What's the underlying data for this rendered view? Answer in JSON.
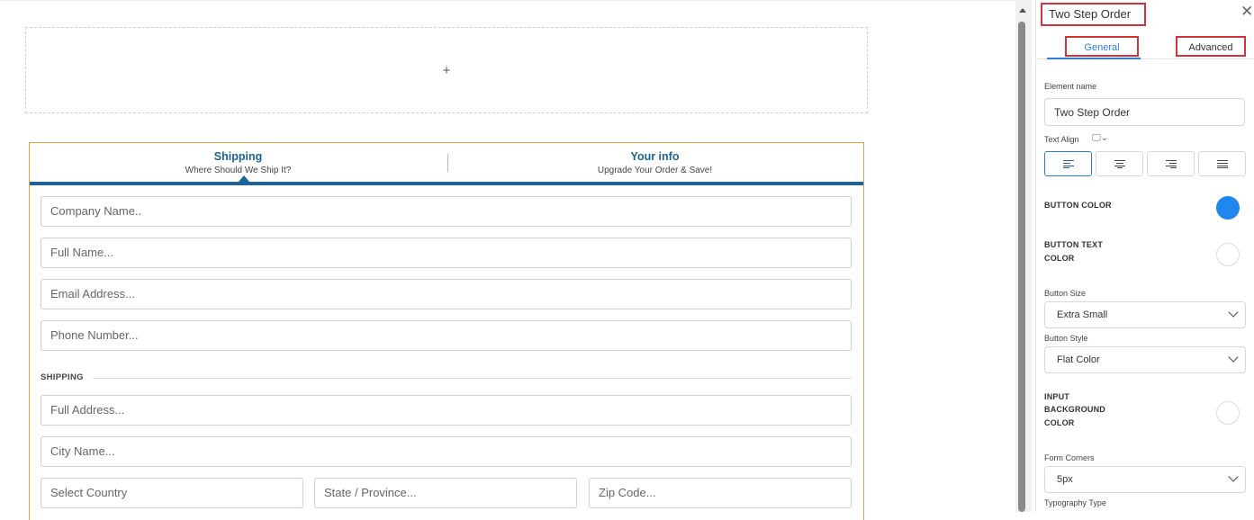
{
  "canvas": {
    "add_section_icon": "+",
    "steps": [
      {
        "title": "Shipping",
        "subtitle": "Where Should We Ship It?"
      },
      {
        "title": "Your info",
        "subtitle": "Upgrade Your Order & Save!"
      }
    ],
    "fields": {
      "company": "Company Name..",
      "full_name": "Full Name...",
      "email": "Email Address...",
      "phone": "Phone Number..."
    },
    "shipping_label": "SHIPPING",
    "shipping_fields": {
      "address": "Full Address...",
      "city": "City Name...",
      "country": "Select Country",
      "state": "State / Province...",
      "zip": "Zip Code..."
    }
  },
  "panel": {
    "title": "Two Step Order",
    "tabs": {
      "general": "General",
      "advanced": "Advanced"
    },
    "element_name_label": "Element name",
    "element_name_value": "Two Step Order",
    "text_align_label": "Text Align",
    "button_color_label": "BUTTON COLOR",
    "button_color": "#1e88ef",
    "button_text_color_label_1": "BUTTON TEXT",
    "button_text_color_label_2": "COLOR",
    "button_text_color": "#ffffff",
    "button_size_label": "Button Size",
    "button_size_value": "Extra Small",
    "button_style_label": "Button Style",
    "button_style_value": "Flat Color",
    "input_bg_label_1": "INPUT",
    "input_bg_label_2": "BACKGROUND",
    "input_bg_label_3": "COLOR",
    "input_bg_color": "#ffffff",
    "form_corners_label": "Form Corners",
    "form_corners_value": "5px",
    "typography_label": "Typography Type"
  }
}
